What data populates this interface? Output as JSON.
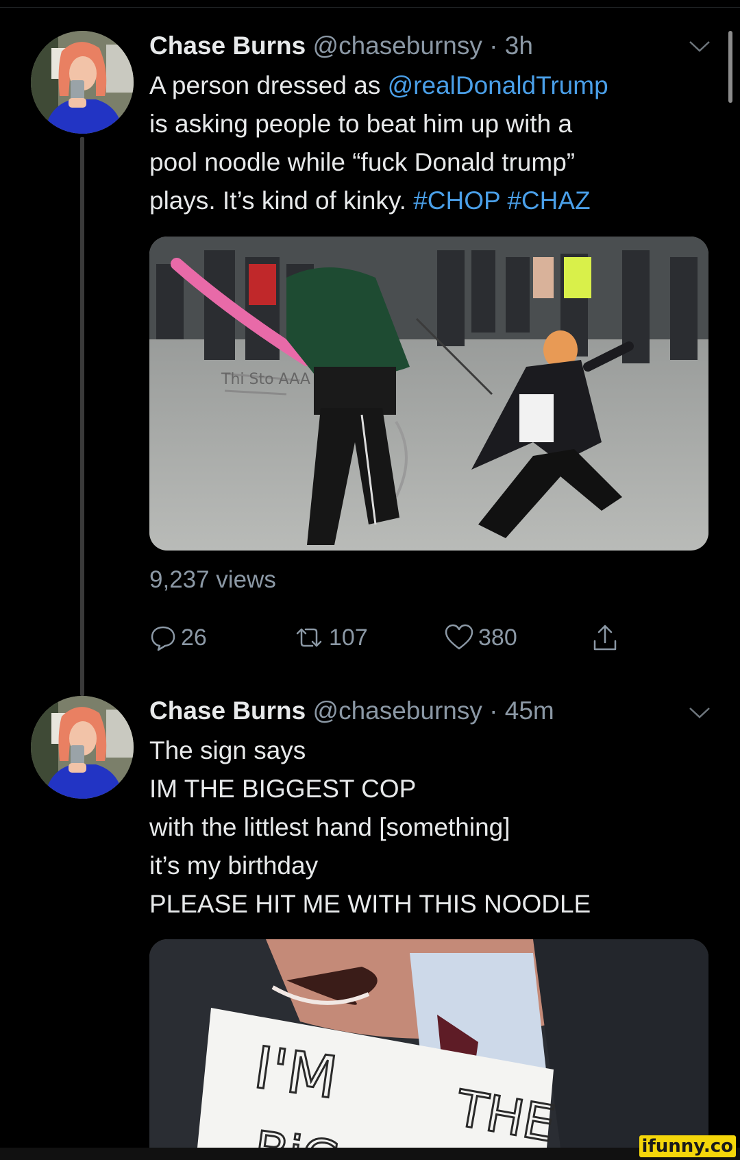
{
  "tweets": [
    {
      "name": "Chase Burns",
      "handle_time": "@chaseburnsy · 3h",
      "text": {
        "l1_pre": "A person dressed as ",
        "l1_mention": "@realDonaldTrump",
        "l2": "is asking people to beat him up with a",
        "l3": "pool noodle while “fuck Donald trump”",
        "l4_pre": "plays. It’s kind of kinky. ",
        "tag1": "#CHOP",
        "tag2": "#CHAZ"
      },
      "media": {
        "sign_text": "Thi Sto AAA"
      },
      "views": "9,237 views",
      "actions": {
        "replies": "26",
        "retweets": "107",
        "likes": "380"
      }
    },
    {
      "name": "Chase Burns",
      "handle_time": "@chaseburnsy · 45m",
      "lines": [
        "The sign says",
        "IM THE BIGGEST COP",
        "with the littlest hand [something]",
        "it’s my birthday",
        "PLEASE HIT ME WITH THIS NOODLE"
      ],
      "media": {
        "sign_line1": "I'M",
        "sign_line2": "THE",
        "sign_line3": "BiG"
      }
    }
  ],
  "watermark": "ifunny.co",
  "colors": {
    "link": "#4a9fe8",
    "secondary": "#8b98a5",
    "background": "#000000"
  }
}
